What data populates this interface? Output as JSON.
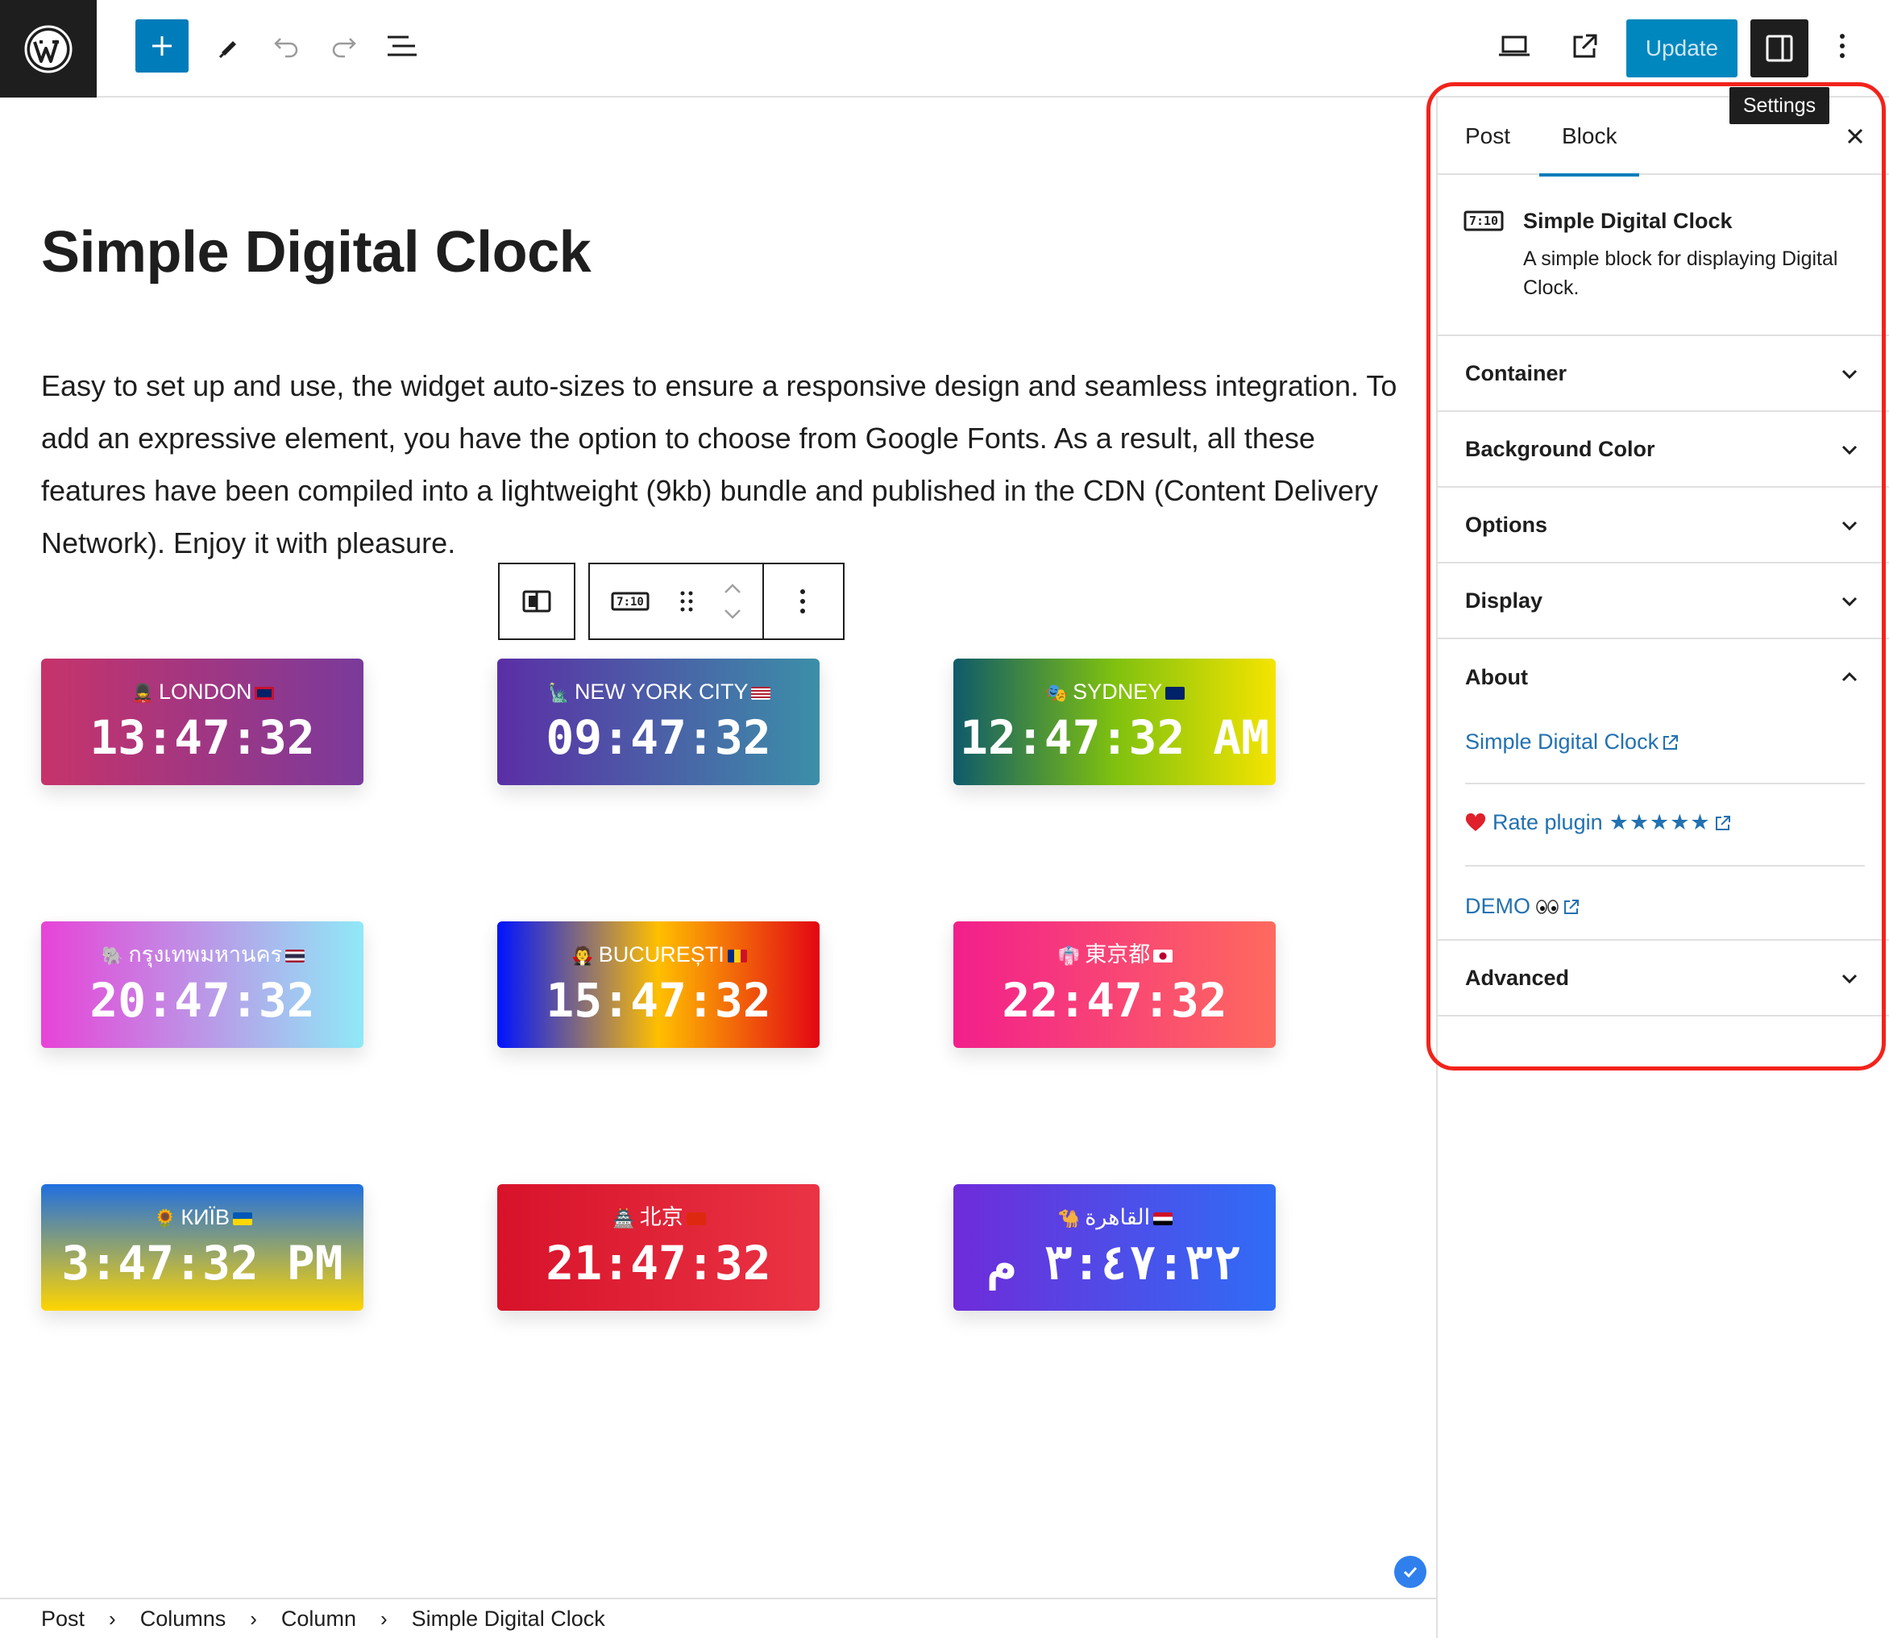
{
  "toolbar": {
    "update_label": "Update",
    "settings_tooltip": "Settings"
  },
  "post": {
    "title": "Simple Digital Clock",
    "paragraph": "Easy to set up and use, the widget auto-sizes to ensure a responsive design and seamless integration. To add an expressive element, you have the option to choose from Google Fonts. As a result, all these features have been compiled into a lightweight (9kb) bundle and published in the CDN (Content Delivery Network). Enjoy it with pleasure."
  },
  "block_toolbar": {
    "block_icon_text": "7:10"
  },
  "clocks": [
    {
      "city": "LONDON",
      "time": "13:47:32",
      "emoji": "💂",
      "colors": [
        "#c7336a",
        "#7a3a9b"
      ]
    },
    {
      "city": "NEW YORK CITY",
      "time": "09:47:32",
      "emoji": "🗽",
      "colors": [
        "#5b2ea6",
        "#3b8fa8"
      ]
    },
    {
      "city": "SYDNEY",
      "time": "12:47:32 AM",
      "emoji": "🎭",
      "colors": [
        "#0e5a6b",
        "#7fc10f",
        "#f5e400"
      ]
    },
    {
      "city": "กรุงเทพมหานคร",
      "time": "20:47:32",
      "emoji": "🐘",
      "colors": [
        "#e843d7",
        "#8fe9f7"
      ]
    },
    {
      "city": "BUCUREȘTI",
      "time": "15:47:32",
      "emoji": "🧛",
      "colors": [
        "#0013ff",
        "#ffbf00",
        "#e30613"
      ]
    },
    {
      "city": "東京都",
      "time": "22:47:32",
      "emoji": "👘",
      "colors": [
        "#f21f8c",
        "#ff6a5e"
      ]
    },
    {
      "city": "КИЇВ",
      "time": "3:47:32 PM",
      "emoji": "🌻",
      "colors": [
        "#1f6fe0",
        "#ffd500"
      ]
    },
    {
      "city": "北京",
      "time": "21:47:32",
      "emoji": "🏯",
      "colors": [
        "#d7122a",
        "#ea3444"
      ]
    },
    {
      "city": "القاهرة",
      "time": "٣:٤٧:٣٢ م",
      "emoji": "🐪",
      "colors": [
        "#6f2bd9",
        "#2f6df6"
      ]
    }
  ],
  "breadcrumb": [
    "Post",
    "Columns",
    "Column",
    "Simple Digital Clock"
  ],
  "sidebar": {
    "tabs": [
      "Post",
      "Block"
    ],
    "active_tab": "Block",
    "block": {
      "icon_text": "7:10",
      "name": "Simple Digital Clock",
      "description": "A simple block for displaying Digital Clock."
    },
    "panels": {
      "container": "Container",
      "background_color": "Background Color",
      "options": "Options",
      "display": "Display",
      "about": "About",
      "advanced": "Advanced"
    },
    "about_links": {
      "plugin": "Simple Digital Clock",
      "rate": "Rate plugin",
      "stars": "★★★★★",
      "demo": "DEMO"
    }
  },
  "colors": {
    "accent": "#007cba",
    "highlight": "#f2231b",
    "link": "#2271b1"
  }
}
